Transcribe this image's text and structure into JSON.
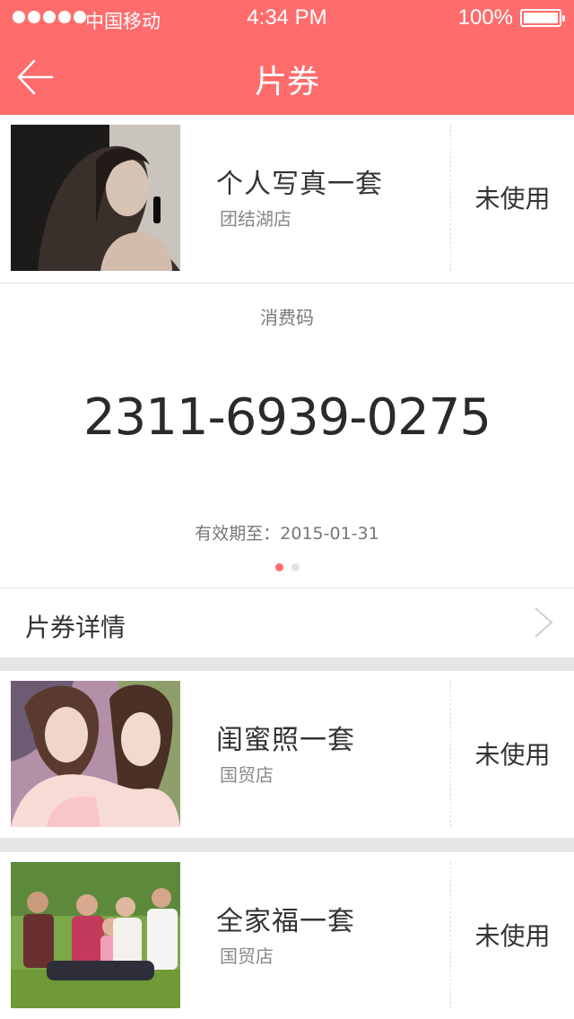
{
  "status_bar": {
    "carrier": "中国移动",
    "time": "4:34 PM",
    "battery": "100%"
  },
  "nav": {
    "title": "片券",
    "back_icon": "arrow-left-icon"
  },
  "coupons": [
    {
      "title": "个人写真一套",
      "store": "团结湖店",
      "status": "未使用",
      "photo": "portrait-woman"
    },
    {
      "title": "闺蜜照一套",
      "store": "国贸店",
      "status": "未使用",
      "photo": "two-girls"
    },
    {
      "title": "全家福一套",
      "store": "国贸店",
      "status": "未使用",
      "photo": "family-lawn"
    }
  ],
  "code_panel": {
    "label": "消费码",
    "code": "2311-6939-0275",
    "expiry": "有效期至：2015-01-31",
    "pager": {
      "total": 2,
      "active": 1
    }
  },
  "detail": {
    "label": "片券详情",
    "chevron_icon": "chevron-right-icon"
  },
  "colors": {
    "accent": "#ff6c6c",
    "separator": "#e6e6e6"
  }
}
